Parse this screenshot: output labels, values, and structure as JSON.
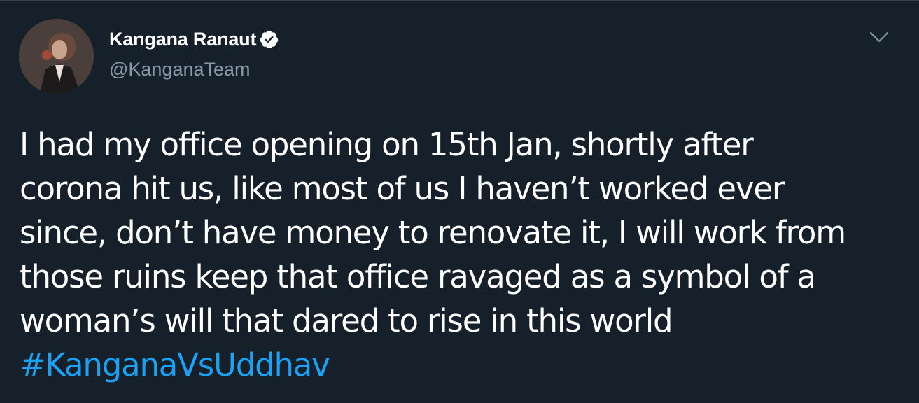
{
  "author": {
    "display_name": "Kangana Ranaut",
    "handle": "@KanganaTeam",
    "verified": true
  },
  "tweet": {
    "lines": [
      "I had my office opening on 15th Jan, shortly after",
      "corona hit us, like most of us I haven’t worked ever",
      "since, don’t have money to renovate it, I will work from",
      "those ruins keep that office ravaged as a symbol of a",
      "woman’s will that dared to rise in this world"
    ],
    "hashtag": "#KanganaVsUddhav"
  },
  "icons": {
    "verified": "verified-badge-icon",
    "menu": "chevron-down-icon"
  },
  "colors": {
    "background": "#15202b",
    "text": "#ffffff",
    "secondary_text": "#8899a6",
    "link": "#1da1f2"
  }
}
